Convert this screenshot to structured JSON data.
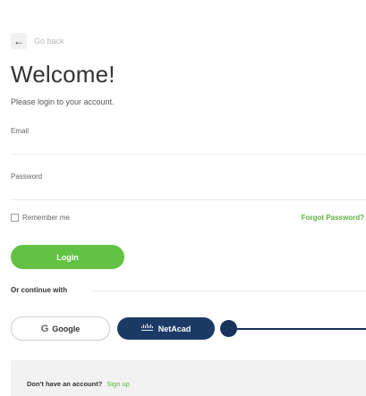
{
  "back": {
    "label": "Go back",
    "icon": "arrow-left-icon"
  },
  "welcome": {
    "title": "Welcome!",
    "subtitle": "Please login to your account."
  },
  "form": {
    "email": {
      "label": "Email",
      "value": "",
      "placeholder": ""
    },
    "password": {
      "label": "Password",
      "value": "",
      "placeholder": ""
    },
    "remember_label": "Remember me",
    "remember_checked": false,
    "forgot_label": "Forgot Password?",
    "login_label": "Login"
  },
  "sso": {
    "divider_label": "Or continue with",
    "google_label": "Google",
    "google_icon": "G",
    "netacad_label": "NetAcad",
    "netacad_icon": "cisco-logo-icon"
  },
  "signup": {
    "prompt": "Don't have an account?",
    "link_label": "Sign up"
  },
  "colors": {
    "accent": "#63c243",
    "brand_dark": "#1b3a66",
    "link": "#5fb33f"
  }
}
